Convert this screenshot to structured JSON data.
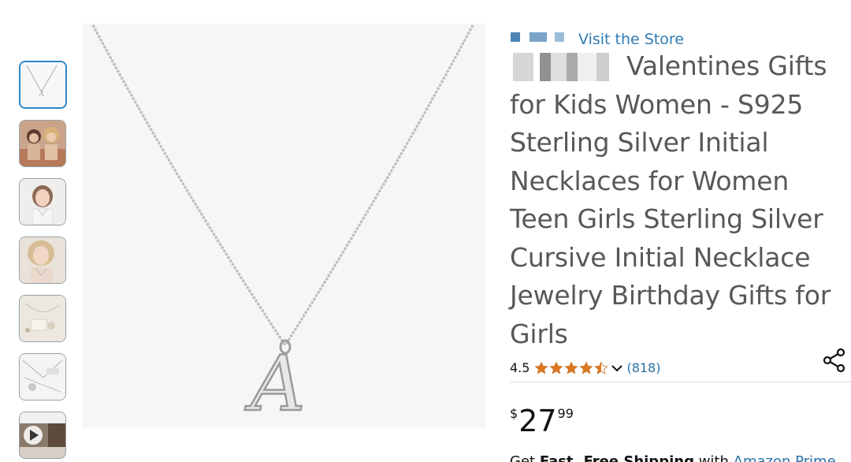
{
  "store_link": "Visit the Store",
  "title": {
    "text": "Valentines Gifts for Kids Women - S925 Sterling Silver Initial Necklaces for Women Teen Girls Sterling Silver Cursive Initial Necklace Jewelry Birthday Gifts for Girls"
  },
  "rating": {
    "value": "4.5",
    "stars": 4.5,
    "count": "(818)",
    "star_color": "#de7921"
  },
  "price": {
    "symbol": "$",
    "whole": "27",
    "fraction": "99"
  },
  "shipping": {
    "prefix": "Get",
    "fast": "Fast",
    "separator": ", ",
    "free": "Free Shipping",
    "with": "with",
    "prime": "Amazon Prime"
  },
  "thumbnails": [
    {
      "name": "thumbnail-necklace",
      "selected": true
    },
    {
      "name": "thumbnail-two-women",
      "selected": false
    },
    {
      "name": "thumbnail-girl",
      "selected": false
    },
    {
      "name": "thumbnail-woman-blonde",
      "selected": false
    },
    {
      "name": "thumbnail-flatlay",
      "selected": false
    },
    {
      "name": "thumbnail-size-chart",
      "selected": false
    },
    {
      "name": "thumbnail-video",
      "selected": false
    }
  ],
  "main_image": {
    "pendant_letter": "A"
  },
  "icons": {
    "share": "share-icon",
    "chevron": "chevron-down-icon",
    "play": "play-icon"
  },
  "colors": {
    "link": "#2a72a8",
    "title_gray": "#565959",
    "selected_border": "#2f86c4"
  }
}
